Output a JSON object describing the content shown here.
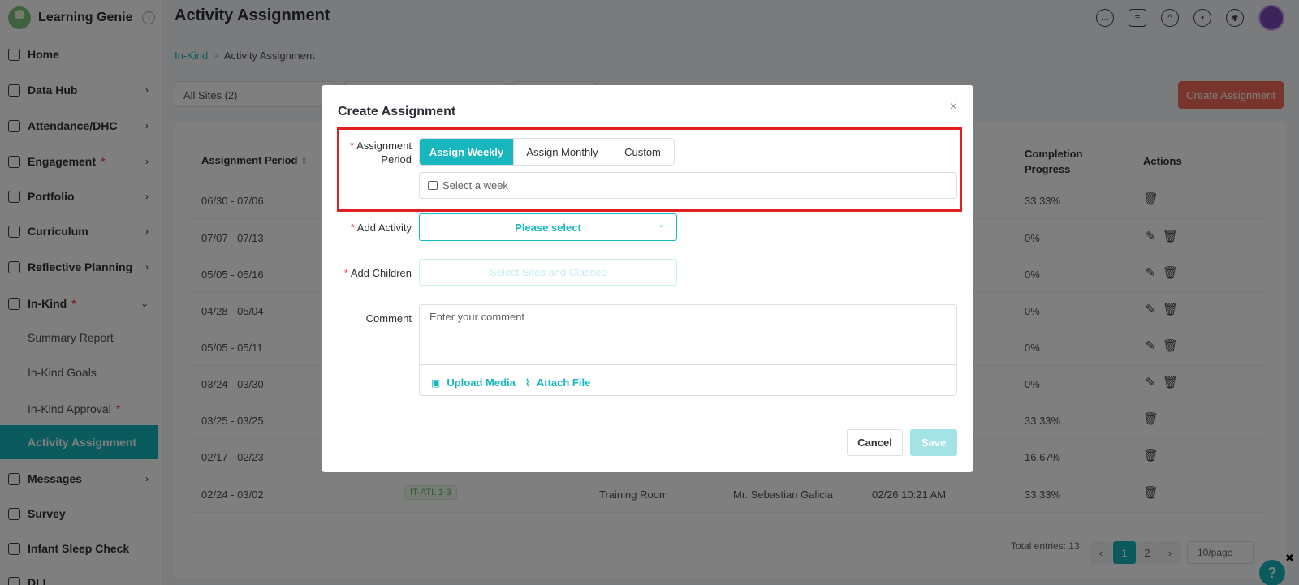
{
  "app": {
    "brand": "Learning Genie",
    "page_title": "Activity Assignment"
  },
  "sidebar": {
    "items": [
      {
        "label": "Home",
        "chevron": ""
      },
      {
        "label": "Data Hub",
        "chevron": "›"
      },
      {
        "label": "Attendance/DHC",
        "chevron": "›"
      },
      {
        "label": "Engagement",
        "chevron": "›",
        "dot": "*"
      },
      {
        "label": "Portfolio",
        "chevron": "›"
      },
      {
        "label": "Curriculum",
        "chevron": "›"
      },
      {
        "label": "Reflective Planning",
        "chevron": "›"
      },
      {
        "label": "In-Kind",
        "chevron": "⌄",
        "dot": "*"
      },
      {
        "label": "Messages",
        "chevron": "›"
      },
      {
        "label": "Survey",
        "chevron": ""
      },
      {
        "label": "Infant Sleep Check",
        "chevron": ""
      },
      {
        "label": "DLL",
        "chevron": ""
      }
    ],
    "sub_items": [
      {
        "label": "Summary Report"
      },
      {
        "label": "In-Kind Goals"
      },
      {
        "label": "In-Kind Approval",
        "dot": "*"
      },
      {
        "label": "Activity Assignment"
      }
    ]
  },
  "header": {
    "icons": [
      "chat-icon",
      "notes-icon",
      "graduation-cap-icon",
      "bell-icon",
      "gear-icon"
    ]
  },
  "breadcrumb": {
    "link": "In-Kind",
    "separator": ">",
    "current": "Activity Assignment"
  },
  "filters": {
    "sites": "All Sites  (2)",
    "create_button": "Create Assignment"
  },
  "table": {
    "headers": {
      "period": "Assignment Period",
      "period_sort": "⇕",
      "progress_line1": "Completion",
      "progress_line2": "Progress",
      "actions": "Actions"
    },
    "rows": [
      {
        "period": "06/30 - 07/06",
        "progress": "33.33%",
        "edit": false
      },
      {
        "period": "07/07 - 07/13",
        "progress": "0%",
        "edit": true
      },
      {
        "period": "05/05 - 05/16",
        "progress": "0%",
        "edit": true
      },
      {
        "period": "04/28 - 05/04",
        "progress": "0%",
        "edit": true
      },
      {
        "period": "05/05 - 05/11",
        "progress": "0%",
        "edit": true
      },
      {
        "period": "03/24 - 03/30",
        "progress": "0%",
        "edit": true
      },
      {
        "period": "03/25 - 03/25",
        "progress": "33.33%",
        "edit": false
      },
      {
        "period": "02/17 - 02/23",
        "progress": "16.67%",
        "edit": false
      },
      {
        "period": "02/24 - 03/02",
        "class": "IT-ATL 1-3",
        "location": "Training Room",
        "teacher": "Mr. Sebastian Galicia",
        "created": "02/26 10:21 AM",
        "progress": "33.33%",
        "edit": false
      }
    ],
    "total": "Total entries: 13",
    "pages": [
      "1",
      "2"
    ],
    "page_size": "10/page"
  },
  "modal": {
    "title": "Create Assignment",
    "close": "×",
    "required_mark": "*",
    "assignment_period_label_1": "Assignment",
    "assignment_period_label_2": "Period",
    "period_options": [
      "Assign Weekly",
      "Assign Monthly",
      "Custom"
    ],
    "week_placeholder": "Select a week",
    "add_activity_label": "Add Activity",
    "activity_placeholder": "Please select",
    "add_children_label": "Add Children",
    "children_placeholder": "Select Sites and Classes",
    "comment_label": "Comment",
    "comment_placeholder": "Enter your comment",
    "upload_media": "Upload Media",
    "attach_file": "Attach File",
    "cancel": "Cancel",
    "save": "Save"
  },
  "help": "?",
  "help_close": "✖"
}
